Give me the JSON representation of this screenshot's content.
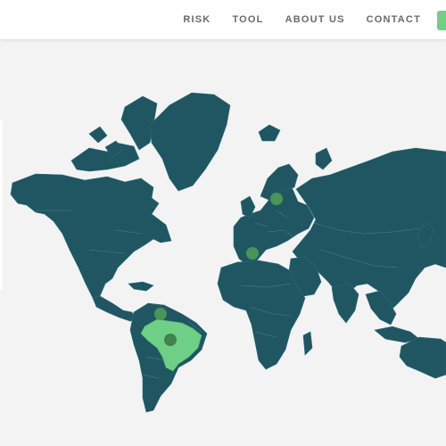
{
  "nav": {
    "items": [
      "RISK",
      "TOOL",
      "ABOUT US",
      "CONTACT"
    ]
  },
  "colors": {
    "land": "#1f5662",
    "highlight_country": "#6fcf86",
    "marker": "#4f9a5a",
    "marker_dark": "#3f7d4c",
    "accent_button": "#6fcf86",
    "background": "#f3f3f4"
  },
  "map": {
    "highlighted_country": "Brazil",
    "markers": [
      {
        "name": "marker-poland",
        "shade": "#4f9a5a"
      },
      {
        "name": "marker-spain-france",
        "shade": "#4f9a5a"
      },
      {
        "name": "marker-venezuela-colombia",
        "shade": "#4f9a5a"
      },
      {
        "name": "marker-brazil",
        "shade": "#3f7d4c"
      }
    ]
  }
}
